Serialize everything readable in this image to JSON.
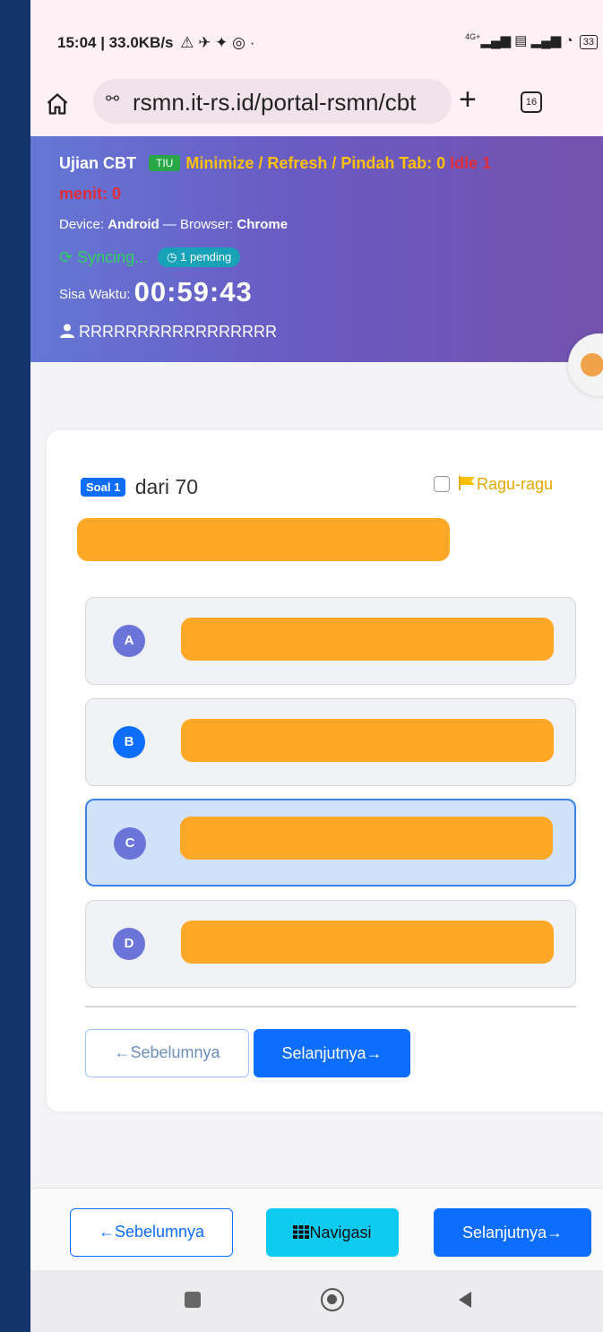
{
  "status_bar": {
    "time_speed": "15:04 | 33.0KB/s",
    "notif_icons": "⚠ ✈ ✦ ◎ ·",
    "network": "4G+",
    "battery": "33"
  },
  "browser": {
    "url": "rsmn.it-rs.id/portal-rsmn/cbt",
    "tab_count": "16"
  },
  "header": {
    "title": "Ujian CBT",
    "badge": "TIU",
    "warning": "Minimize / Refresh / Pindah Tab: 0",
    "idle_part1": "Idle 1",
    "idle_part2": "menit: 0",
    "device_label": "Device:",
    "device_value": "Android",
    "browser_label": "— Browser:",
    "browser_value": "Chrome",
    "sync_text": "Syncing...",
    "pending_text": "1 pending",
    "timer_label": "Sisa Waktu:",
    "timer_value": "00:59:43",
    "user_name": "RRRRRRRRRRRRRRRRR"
  },
  "question": {
    "badge": "Soal 1",
    "of_text": "dari 70",
    "ragu_label": "Ragu-ragu",
    "options": [
      {
        "letter": "A",
        "selected": false
      },
      {
        "letter": "B",
        "selected": false
      },
      {
        "letter": "C",
        "selected": true
      },
      {
        "letter": "D",
        "selected": false
      }
    ]
  },
  "card_nav": {
    "prev_label": "Sebelumnya",
    "next_label": "Selanjutnya"
  },
  "bottom_nav": {
    "prev_label": "Sebelumnya",
    "nav_label": "Navigasi",
    "next_label": "Selanjutnya"
  },
  "colors": {
    "primary": "#0d6efd",
    "warning": "#ffc107",
    "danger": "#e02c3a",
    "success": "#2fd25e",
    "info": "#0dcaf0",
    "redacted": "#ffa726"
  }
}
